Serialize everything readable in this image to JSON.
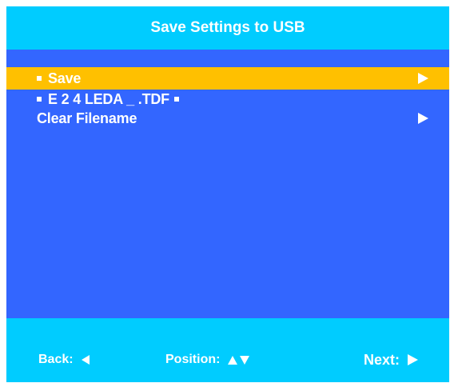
{
  "header": {
    "title": "Save Settings to USB"
  },
  "menu": {
    "items": [
      {
        "label": "Save",
        "bullet": true,
        "selected": true,
        "has_submenu": true,
        "arrow_icon": "arrow-right-icon"
      },
      {
        "label": "E 2 4 LEDA _ .TDF",
        "bullet": true,
        "trailing_bullet": true,
        "selected": false,
        "has_submenu": false
      },
      {
        "label": "Clear Filename",
        "bullet": false,
        "selected": false,
        "has_submenu": true,
        "arrow_icon": "arrow-right-icon"
      }
    ]
  },
  "footer": {
    "back_label": "Back:",
    "back_icon": "arrow-left-icon",
    "position_label": "Position:",
    "position_icons": [
      "arrow-up-icon",
      "arrow-down-icon"
    ],
    "next_label": "Next:",
    "next_icon": "arrow-right-icon"
  },
  "colors": {
    "background": "#3366ff",
    "bars": "#00ccff",
    "highlight": "#ffc000",
    "text": "#ffffff"
  }
}
